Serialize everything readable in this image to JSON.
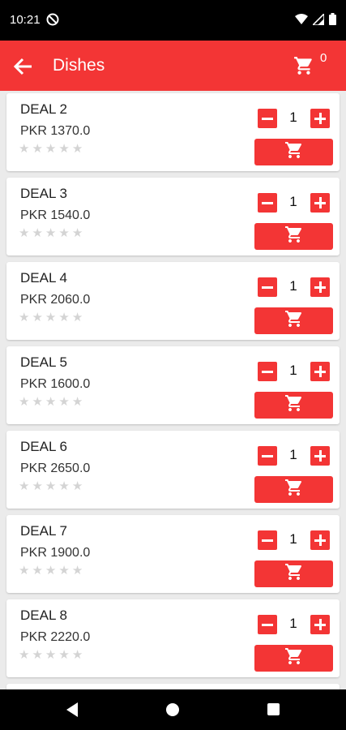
{
  "status_bar": {
    "time": "10:21",
    "icons": [
      "dnd-icon",
      "wifi-icon",
      "signal-icon",
      "battery-icon"
    ]
  },
  "app_bar": {
    "title": "Dishes",
    "cart_count": "0",
    "back_icon": "arrow-left-icon",
    "cart_icon": "cart-icon"
  },
  "colors": {
    "accent": "#f33535",
    "background": "#ebebeb",
    "card": "#ffffff",
    "star_empty": "#d4d4d4"
  },
  "dishes": [
    {
      "name": "DEAL 2",
      "price": "PKR 1370.0",
      "qty": "1",
      "rating": 0
    },
    {
      "name": "DEAL 3",
      "price": "PKR 1540.0",
      "qty": "1",
      "rating": 0
    },
    {
      "name": "DEAL 4",
      "price": "PKR 2060.0",
      "qty": "1",
      "rating": 0
    },
    {
      "name": "DEAL 5",
      "price": "PKR 1600.0",
      "qty": "1",
      "rating": 0
    },
    {
      "name": "DEAL 6",
      "price": "PKR 2650.0",
      "qty": "1",
      "rating": 0
    },
    {
      "name": "DEAL 7",
      "price": "PKR 1900.0",
      "qty": "1",
      "rating": 0
    },
    {
      "name": "DEAL 8",
      "price": "PKR 2220.0",
      "qty": "1",
      "rating": 0
    }
  ]
}
